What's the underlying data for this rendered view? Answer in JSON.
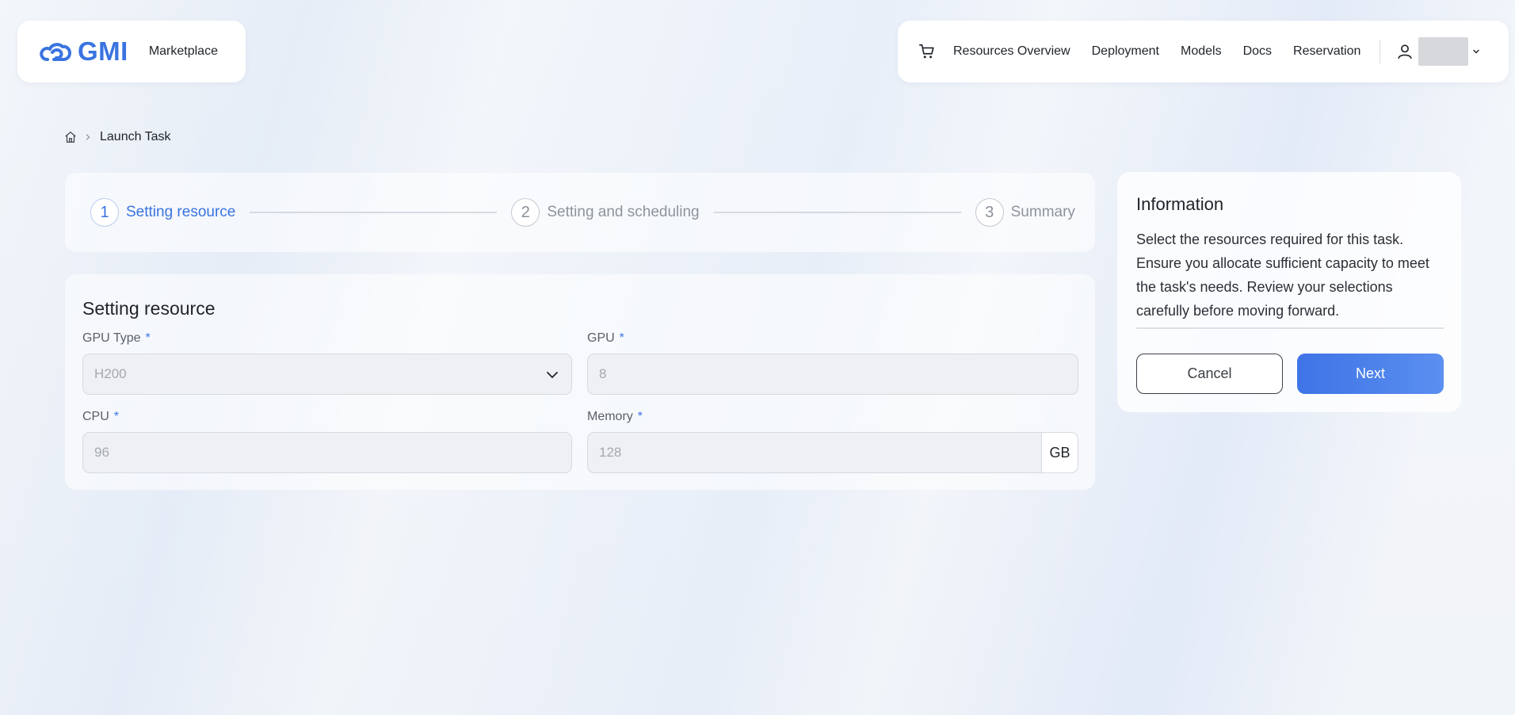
{
  "header": {
    "logo_text": "GMI",
    "brand_label": "Marketplace",
    "nav": [
      {
        "label": "Resources Overview"
      },
      {
        "label": "Deployment"
      },
      {
        "label": "Models"
      },
      {
        "label": "Docs"
      },
      {
        "label": "Reservation"
      }
    ],
    "icons": {
      "cart": "cart-icon",
      "user": "user-icon",
      "dropdown": "chevron-down-icon"
    }
  },
  "breadcrumb": {
    "home_icon": "home-icon",
    "current": "Launch Task"
  },
  "steps": [
    {
      "number": "1",
      "label": "Setting resource",
      "active": true
    },
    {
      "number": "2",
      "label": "Setting and scheduling",
      "active": false
    },
    {
      "number": "3",
      "label": "Summary",
      "active": false
    }
  ],
  "form": {
    "title": "Setting resource",
    "required_mark": "*",
    "gpu_type": {
      "label": "GPU Type",
      "value": "H200"
    },
    "gpu": {
      "label": "GPU",
      "value": "8"
    },
    "cpu": {
      "label": "CPU",
      "value": "96"
    },
    "memory": {
      "label": "Memory",
      "value": "128",
      "unit": "GB"
    }
  },
  "info": {
    "title": "Information",
    "text": "Select the resources required for this task. Ensure you allocate sufficient capacity to meet the task's needs. Review your selections carefully before moving forward.",
    "cancel_label": "Cancel",
    "next_label": "Next"
  },
  "colors": {
    "accent": "#3a74e0",
    "next_button_start": "#3e74e6",
    "next_button_end": "#5b8ff0",
    "field_bg": "#eef0f4"
  }
}
